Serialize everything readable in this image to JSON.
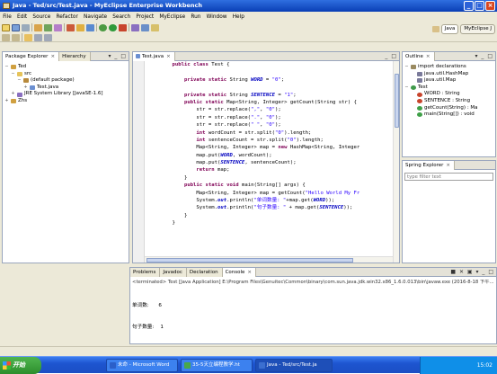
{
  "window": {
    "title": "Java - Ted/src/Test.java - MyEclipse Enterprise Workbench",
    "min": "_",
    "max": "□",
    "close": "×"
  },
  "menu": [
    "File",
    "Edit",
    "Source",
    "Refactor",
    "Navigate",
    "Search",
    "Project",
    "MyEclipse",
    "Run",
    "Window",
    "Help"
  ],
  "perspectives": [
    "Java",
    "MyEclipse J"
  ],
  "left_panel": {
    "tabs": [
      "Package Explorer",
      "Hierarchy"
    ],
    "tree": [
      {
        "label": "Ted",
        "indent": 0,
        "twisty": "−",
        "icon": "project-icon"
      },
      {
        "label": "src",
        "indent": 1,
        "twisty": "−",
        "icon": "folder-icon"
      },
      {
        "label": "(default package)",
        "indent": 2,
        "twisty": "−",
        "icon": "package-icon"
      },
      {
        "label": "Test.java",
        "indent": 3,
        "twisty": "+",
        "icon": "java-file-icon"
      },
      {
        "label": "JRE System Library [JavaSE-1.6]",
        "indent": 1,
        "twisty": "+",
        "icon": "library-icon"
      },
      {
        "label": "Zhs",
        "indent": 0,
        "twisty": "+",
        "icon": "project-icon"
      }
    ]
  },
  "editor": {
    "tab": "Test.java",
    "lines": [
      [
        {
          "t": "    "
        },
        {
          "t": "public",
          "c": "kw"
        },
        {
          "t": " "
        },
        {
          "t": "class",
          "c": "kw"
        },
        {
          "t": " Test {"
        }
      ],
      [],
      [
        {
          "t": "        "
        },
        {
          "t": "private",
          "c": "kw"
        },
        {
          "t": " "
        },
        {
          "t": "static",
          "c": "kw"
        },
        {
          "t": " String "
        },
        {
          "t": "WORD",
          "c": "fi"
        },
        {
          "t": " = "
        },
        {
          "t": "\"0\"",
          "c": "st"
        },
        {
          "t": ";"
        }
      ],
      [],
      [
        {
          "t": "        "
        },
        {
          "t": "private",
          "c": "kw"
        },
        {
          "t": " "
        },
        {
          "t": "static",
          "c": "kw"
        },
        {
          "t": " String "
        },
        {
          "t": "SENTENCE",
          "c": "fi"
        },
        {
          "t": " = "
        },
        {
          "t": "\"1\"",
          "c": "st"
        },
        {
          "t": ";"
        }
      ],
      [
        {
          "t": "        "
        },
        {
          "t": "public",
          "c": "kw"
        },
        {
          "t": " "
        },
        {
          "t": "static",
          "c": "kw"
        },
        {
          "t": " Map<String, Integer> getCount(String str) {"
        }
      ],
      [
        {
          "t": "            str = str.replace("
        },
        {
          "t": "\",\"",
          "c": "st"
        },
        {
          "t": ", "
        },
        {
          "t": "\"0\"",
          "c": "st"
        },
        {
          "t": ");"
        }
      ],
      [
        {
          "t": "            str = str.replace("
        },
        {
          "t": "\".\"",
          "c": "st"
        },
        {
          "t": ", "
        },
        {
          "t": "\"0\"",
          "c": "st"
        },
        {
          "t": ");"
        }
      ],
      [
        {
          "t": "            str = str.replace("
        },
        {
          "t": "\" \"",
          "c": "st"
        },
        {
          "t": ", "
        },
        {
          "t": "\"0\"",
          "c": "st"
        },
        {
          "t": ");"
        }
      ],
      [
        {
          "t": "            "
        },
        {
          "t": "int",
          "c": "kw"
        },
        {
          "t": " wordCount = str.split("
        },
        {
          "t": "\"0\"",
          "c": "st"
        },
        {
          "t": ").length;"
        }
      ],
      [
        {
          "t": "            "
        },
        {
          "t": "int",
          "c": "kw"
        },
        {
          "t": " sentenceCount = str.split("
        },
        {
          "t": "\"0\"",
          "c": "st"
        },
        {
          "t": ").length;"
        }
      ],
      [
        {
          "t": "            Map<String, Integer> map = "
        },
        {
          "t": "new",
          "c": "kw"
        },
        {
          "t": " HashMap<String, Integer"
        }
      ],
      [
        {
          "t": "            map.put("
        },
        {
          "t": "WORD",
          "c": "fi"
        },
        {
          "t": ", wordCount);"
        }
      ],
      [
        {
          "t": "            map.put("
        },
        {
          "t": "SENTENCE",
          "c": "fi"
        },
        {
          "t": ", sentenceCount);"
        }
      ],
      [
        {
          "t": "            "
        },
        {
          "t": "return",
          "c": "kw"
        },
        {
          "t": " map;"
        }
      ],
      [
        {
          "t": "        }"
        }
      ],
      [
        {
          "t": "        "
        },
        {
          "t": "public",
          "c": "kw"
        },
        {
          "t": " "
        },
        {
          "t": "static",
          "c": "kw"
        },
        {
          "t": " "
        },
        {
          "t": "void",
          "c": "kw"
        },
        {
          "t": " main(String[] args) {"
        }
      ],
      [
        {
          "t": "            Map<String, Integer> map = getCount("
        },
        {
          "t": "\"Hello World My Fr",
          "c": "st"
        }
      ],
      [
        {
          "t": "            System."
        },
        {
          "t": "out",
          "c": "fi"
        },
        {
          "t": ".println("
        },
        {
          "t": "\"单词数量: \"",
          "c": "st"
        },
        {
          "t": "+map.get("
        },
        {
          "t": "WORD",
          "c": "fi"
        },
        {
          "t": "));"
        }
      ],
      [
        {
          "t": "            System."
        },
        {
          "t": "out",
          "c": "fi"
        },
        {
          "t": ".println("
        },
        {
          "t": "\"句子数量: \"",
          "c": "st"
        },
        {
          "t": " + map.get("
        },
        {
          "t": "SENTENCE",
          "c": "fi"
        },
        {
          "t": "));"
        }
      ],
      [
        {
          "t": "        }"
        }
      ],
      [
        {
          "t": "    }"
        }
      ]
    ]
  },
  "outline": {
    "tabs": [
      "Outline"
    ],
    "tree": [
      {
        "label": "import declarations",
        "indent": 0,
        "twisty": "−",
        "icon": "import-icon"
      },
      {
        "label": "java.util.HashMap",
        "indent": 1,
        "twisty": "",
        "icon": "import-item-icon"
      },
      {
        "label": "java.util.Map",
        "indent": 1,
        "twisty": "",
        "icon": "import-item-icon"
      },
      {
        "label": "Test",
        "indent": 0,
        "twisty": "−",
        "icon": "class-icon"
      },
      {
        "label": "WORD : String",
        "indent": 1,
        "twisty": "",
        "icon": "field-icon"
      },
      {
        "label": "SENTENCE : String",
        "indent": 1,
        "twisty": "",
        "icon": "field-icon"
      },
      {
        "label": "getCount(String) : Ma",
        "indent": 1,
        "twisty": "",
        "icon": "method-icon"
      },
      {
        "label": "main(String[]) : void",
        "indent": 1,
        "twisty": "",
        "icon": "method-icon"
      }
    ]
  },
  "spring": {
    "tab": "Spring Explorer",
    "filter_placeholder": "type filter text"
  },
  "console": {
    "tabs": [
      "Problems",
      "Javadoc",
      "Declaration",
      "Console"
    ],
    "header": "<terminated> Test [Java Application] E:\\Program Files\\Genuitec\\Common\\binary\\com.sun.java.jdk.win32.x86_1.6.0.013\\bin\\javaw.exe (2016-8-18 下午...",
    "output": [
      {
        "label": "单词数:",
        "value": "6"
      },
      {
        "label": "句子数量:",
        "value": "1"
      }
    ]
  },
  "taskbar": {
    "start": "开始",
    "tasks": [
      {
        "label": "未命 - Microsoft Word",
        "color": "#2b5fc9"
      },
      {
        "label": "35-5天立编程教学.ht",
        "color": "#49a84a"
      },
      {
        "label": "Java - Ted/src/Test.ja",
        "color": "#3b6fd0"
      }
    ],
    "time": "15:02"
  },
  "colors": {
    "accent": "#0a3fb5",
    "keyword": "#7f0055",
    "string": "#2a00ff",
    "field": "#0000c0"
  }
}
